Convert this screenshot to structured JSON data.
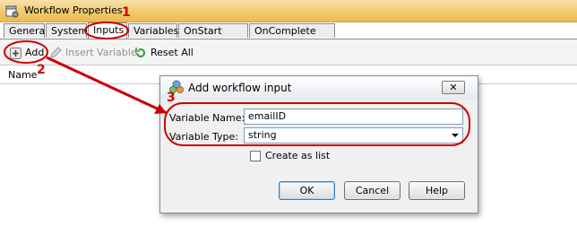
{
  "window": {
    "title": "Workflow Properties",
    "icon": "workflow-properties-icon"
  },
  "tabs": [
    {
      "label": "General",
      "active": false
    },
    {
      "label": "System",
      "active": false
    },
    {
      "label": "Inputs",
      "active": true
    },
    {
      "label": "Variables",
      "active": false
    },
    {
      "label": "OnStart Script",
      "active": false
    },
    {
      "label": "OnComplete Script",
      "active": false
    }
  ],
  "toolbar": {
    "add_label": "Add",
    "insert_variable_label": "Insert Variable",
    "reset_all_label": "Reset All"
  },
  "grid": {
    "columns": [
      "Name"
    ]
  },
  "dialog": {
    "title": "Add workflow input",
    "close_label": "✕",
    "variable_name_label": "Variable Name:",
    "variable_name_value": "emailID",
    "variable_type_label": "Variable Type:",
    "variable_type_value": "string",
    "create_as_list_label": "Create as list",
    "create_as_list_checked": false,
    "ok_label": "OK",
    "cancel_label": "Cancel",
    "help_label": "Help"
  },
  "annotations": [
    "1",
    "2",
    "3"
  ],
  "colors": {
    "annotation": "#cc0000",
    "titlebar": "#f0c86a"
  }
}
